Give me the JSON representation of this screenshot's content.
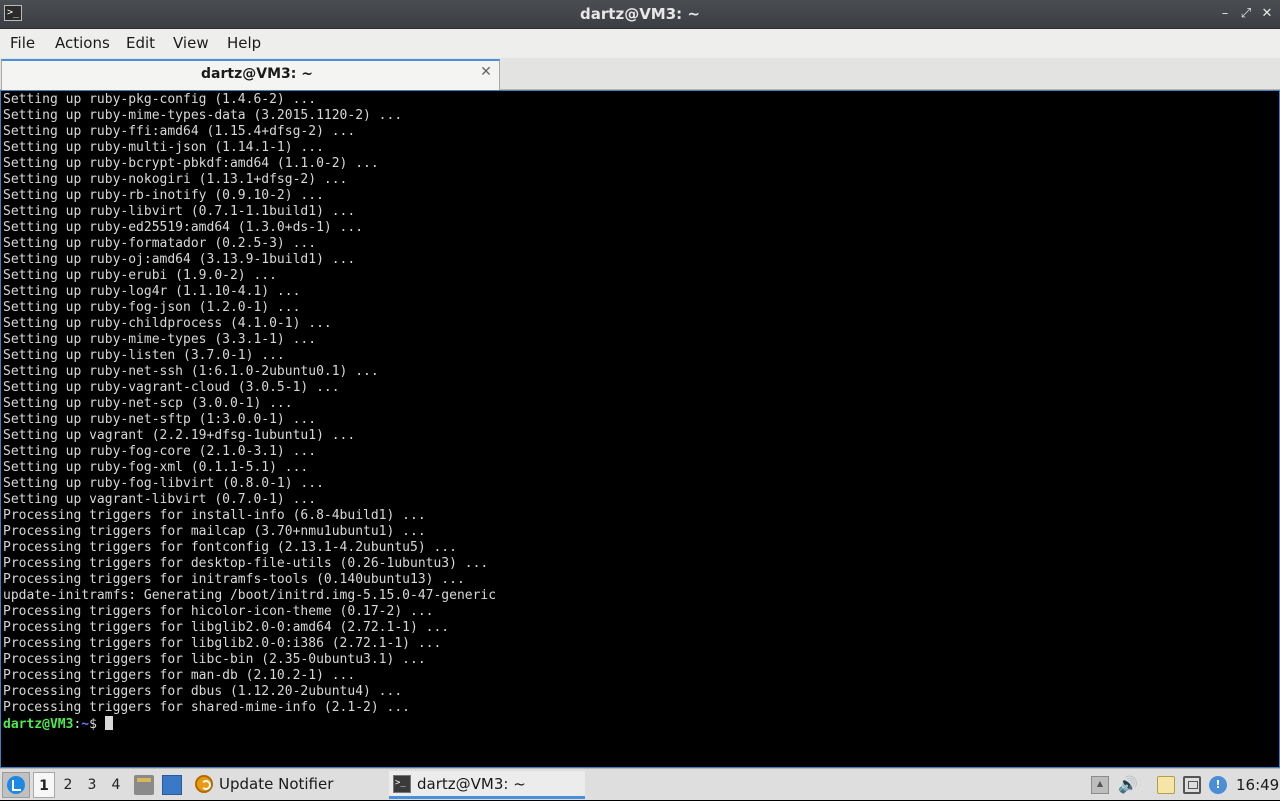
{
  "window": {
    "title": "dartz@VM3: ~",
    "app_icon_glyph": ">_",
    "controls": {
      "minimize_glyph": "–",
      "maximize_glyph": "⤢",
      "close_glyph": "✕"
    }
  },
  "menubar": {
    "items": [
      "File",
      "Actions",
      "Edit",
      "View",
      "Help"
    ]
  },
  "tabs": [
    {
      "label": "dartz@VM3: ~",
      "close_glyph": "✕",
      "active": true
    }
  ],
  "terminal": {
    "lines": [
      "Setting up ruby-pkg-config (1.4.6-2) ...",
      "Setting up ruby-mime-types-data (3.2015.1120-2) ...",
      "Setting up ruby-ffi:amd64 (1.15.4+dfsg-2) ...",
      "Setting up ruby-multi-json (1.14.1-1) ...",
      "Setting up ruby-bcrypt-pbkdf:amd64 (1.1.0-2) ...",
      "Setting up ruby-nokogiri (1.13.1+dfsg-2) ...",
      "Setting up ruby-rb-inotify (0.9.10-2) ...",
      "Setting up ruby-libvirt (0.7.1-1.1build1) ...",
      "Setting up ruby-ed25519:amd64 (1.3.0+ds-1) ...",
      "Setting up ruby-formatador (0.2.5-3) ...",
      "Setting up ruby-oj:amd64 (3.13.9-1build1) ...",
      "Setting up ruby-erubi (1.9.0-2) ...",
      "Setting up ruby-log4r (1.1.10-4.1) ...",
      "Setting up ruby-fog-json (1.2.0-1) ...",
      "Setting up ruby-childprocess (4.1.0-1) ...",
      "Setting up ruby-mime-types (3.3.1-1) ...",
      "Setting up ruby-listen (3.7.0-1) ...",
      "Setting up ruby-net-ssh (1:6.1.0-2ubuntu0.1) ...",
      "Setting up ruby-vagrant-cloud (3.0.5-1) ...",
      "Setting up ruby-net-scp (3.0.0-1) ...",
      "Setting up ruby-net-sftp (1:3.0.0-1) ...",
      "Setting up vagrant (2.2.19+dfsg-1ubuntu1) ...",
      "Setting up ruby-fog-core (2.1.0-3.1) ...",
      "Setting up ruby-fog-xml (0.1.1-5.1) ...",
      "Setting up ruby-fog-libvirt (0.8.0-1) ...",
      "Setting up vagrant-libvirt (0.7.0-1) ...",
      "Processing triggers for install-info (6.8-4build1) ...",
      "Processing triggers for mailcap (3.70+nmu1ubuntu1) ...",
      "Processing triggers for fontconfig (2.13.1-4.2ubuntu5) ...",
      "Processing triggers for desktop-file-utils (0.26-1ubuntu3) ...",
      "Processing triggers for initramfs-tools (0.140ubuntu13) ...",
      "update-initramfs: Generating /boot/initrd.img-5.15.0-47-generic",
      "Processing triggers for hicolor-icon-theme (0.17-2) ...",
      "Processing triggers for libglib2.0-0:amd64 (2.72.1-1) ...",
      "Processing triggers for libglib2.0-0:i386 (2.72.1-1) ...",
      "Processing triggers for libc-bin (2.35-0ubuntu3.1) ...",
      "Processing triggers for man-db (2.10.2-1) ...",
      "Processing triggers for dbus (1.12.20-2ubuntu4) ...",
      "Processing triggers for shared-mime-info (2.1-2) ..."
    ],
    "prompt": {
      "user_host": "dartz@VM3",
      "separator": ":",
      "path": "~",
      "symbol": "$"
    }
  },
  "taskbar": {
    "desktops": [
      "1",
      "2",
      "3",
      "4"
    ],
    "active_desktop": "1",
    "quicklaunch": [
      {
        "icon": "file-manager-icon"
      },
      {
        "icon": "show-desktop-icon"
      }
    ],
    "tasks": [
      {
        "label": "Update Notifier",
        "icon": "update-notifier-icon",
        "active": false
      },
      {
        "label": "dartz@VM3: ~",
        "icon": "terminal-icon",
        "active": true
      }
    ],
    "tray": [
      {
        "icon": "tray-expand-icon",
        "glyph": "▲"
      },
      {
        "icon": "volume-icon",
        "glyph": "🔊"
      },
      {
        "icon": "clipboard-icon"
      },
      {
        "icon": "network-icon"
      },
      {
        "icon": "notification-icon",
        "glyph": "!"
      }
    ],
    "clock": "16:49"
  },
  "colors": {
    "terminal_bg": "#000000",
    "terminal_fg": "#d8d8d8",
    "prompt_user": "#4ee94e",
    "prompt_path": "#5c7cff",
    "accent": "#4a90d9"
  }
}
